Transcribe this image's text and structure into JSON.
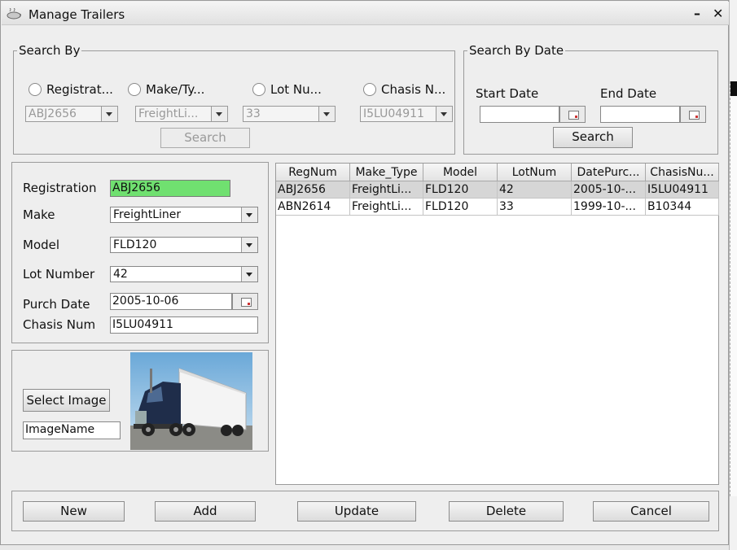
{
  "window": {
    "title": "Manage Trailers",
    "minimize": "–",
    "close": "✕"
  },
  "search_by": {
    "legend": "Search By",
    "options": [
      {
        "label": "Registrat..."
      },
      {
        "label": "Make/Ty..."
      },
      {
        "label": "Lot Nu..."
      },
      {
        "label": "Chasis N..."
      }
    ],
    "combos": [
      "ABJ2656",
      "FreightLi...",
      "33",
      "I5LU04911"
    ],
    "search_label": "Search"
  },
  "search_by_date": {
    "legend": "Search By Date",
    "start_label": "Start Date",
    "end_label": "End Date",
    "start_value": "",
    "end_value": "",
    "search_label": "Search"
  },
  "form": {
    "registration_label": "Registration",
    "registration_value": "ABJ2656",
    "make_label": "Make",
    "make_value": "FreightLiner",
    "model_label": "Model",
    "model_value": "FLD120",
    "lot_label": "Lot Number",
    "lot_value": "42",
    "purch_label": "Purch Date",
    "purch_value": "2005-10-06",
    "chasis_label": "Chasis Num",
    "chasis_value": "I5LU04911",
    "highlight_color": "#70e070"
  },
  "image_panel": {
    "select_label": "Select Image",
    "image_name": "ImageName"
  },
  "table": {
    "columns": [
      "RegNum",
      "Make_Type",
      "Model",
      "LotNum",
      "DatePurc...",
      "ChasisNu..."
    ],
    "rows": [
      [
        "ABJ2656",
        "FreightLi...",
        "FLD120",
        "42",
        "2005-10-...",
        "I5LU04911"
      ],
      [
        "ABN2614",
        "FreightLi...",
        "FLD120",
        "33",
        "1999-10-...",
        "B10344"
      ]
    ],
    "selected_row": 0
  },
  "actions": {
    "new": "New",
    "add": "Add",
    "update": "Update",
    "delete": "Delete",
    "cancel": "Cancel"
  },
  "icons": {
    "app": "coffee-cup-icon",
    "calendar": "calendar-icon",
    "dropdown": "chevron-down-icon"
  }
}
